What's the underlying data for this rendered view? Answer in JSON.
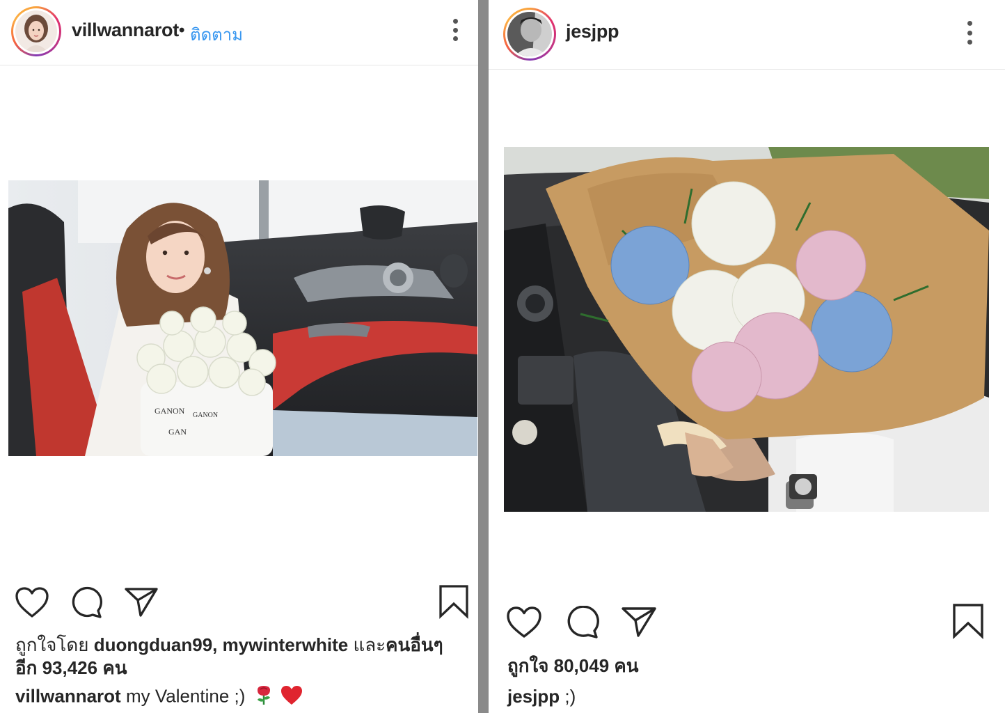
{
  "left_post": {
    "username": "villwannarot",
    "separator": "•",
    "follow_label": "ติดตาม",
    "likes": {
      "prefix": "ถูกใจโดย",
      "user1": "duongduan99,",
      "user2": "mywinterwhite",
      "and": "และ",
      "others": "คนอื่นๆ",
      "count_line": "อีก 93,426 คน"
    },
    "caption": {
      "username": "villwannarot",
      "text": "my Valentine ;)",
      "emoji": [
        "rose",
        "red-heart"
      ]
    },
    "photo": "woman in car holding box of white roses"
  },
  "right_post": {
    "username": "jesjpp",
    "likes_text": "ถูกใจ 80,049 คน",
    "caption": {
      "username": "jesjpp",
      "text": ";)"
    },
    "photo": "bouquet of blue, white and pink hydrangeas wrapped in kraft paper in car"
  },
  "icons": [
    "heart-icon",
    "comment-icon",
    "share-icon",
    "bookmark-icon",
    "more-icon"
  ],
  "colors": {
    "follow_blue": "#3897f0",
    "text": "#262626",
    "divider": "#8a8a8a",
    "heart_red": "#e0242f"
  }
}
